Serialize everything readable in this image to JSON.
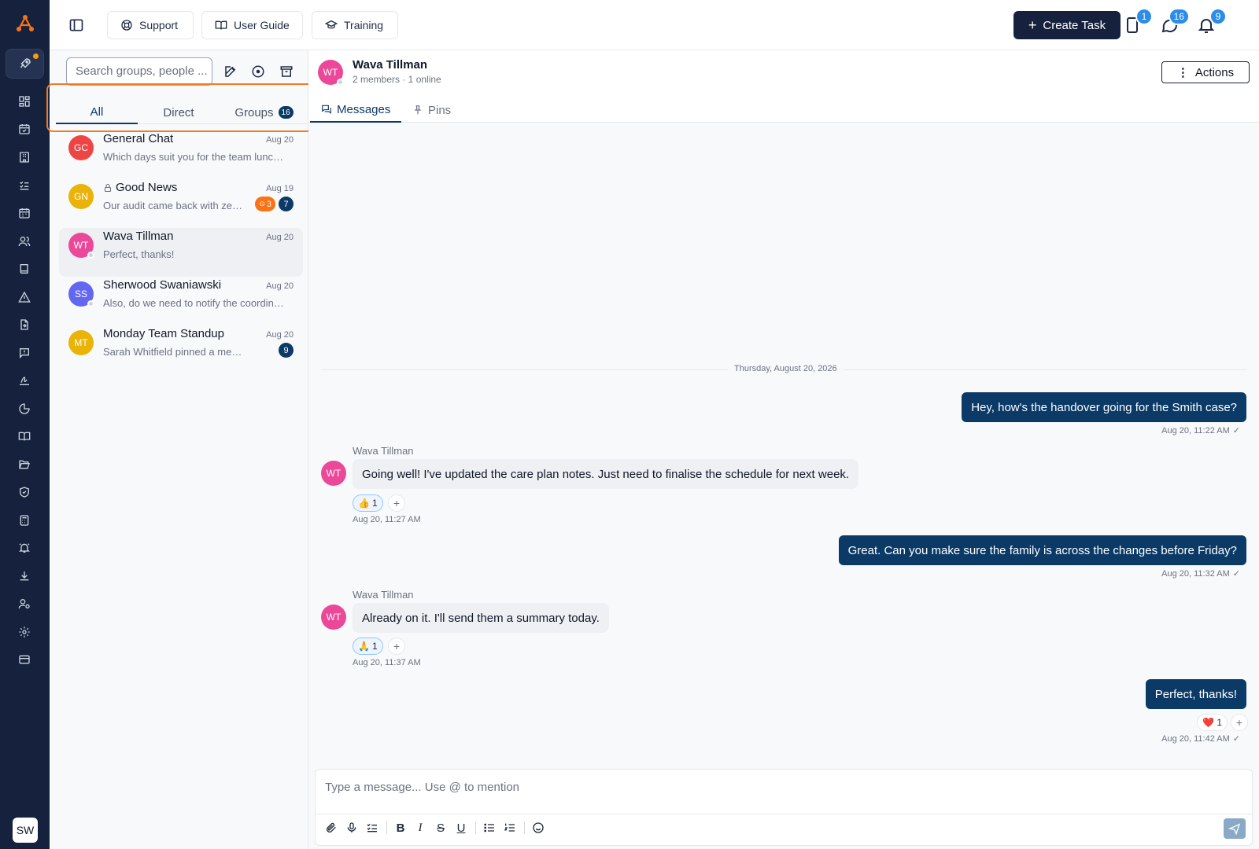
{
  "rail": {
    "user_initials": "SW",
    "icons": [
      "dashboard-icon",
      "calendar-check-icon",
      "building-icon",
      "checklist-icon",
      "calendar-icon",
      "users-icon",
      "book-icon",
      "warning-icon",
      "file-import-icon",
      "message-alert-icon",
      "signature-icon",
      "pie-chart-icon",
      "book-open-icon",
      "folder-open-icon",
      "shield-check-icon",
      "calculator-icon",
      "bell-ring-icon",
      "download-icon",
      "user-cog-icon",
      "settings-icon",
      "credit-card-icon"
    ]
  },
  "topbar": {
    "support_label": "Support",
    "user_guide_label": "User Guide",
    "training_label": "Training",
    "create_task_label": "Create Task",
    "tasks_badge": "1",
    "messages_badge": "16",
    "notifications_badge": "9"
  },
  "list": {
    "search_placeholder": "Search groups, people ...",
    "tabs": [
      {
        "label": "All"
      },
      {
        "label": "Direct"
      },
      {
        "label": "Groups",
        "count": "16"
      }
    ],
    "conversations": [
      {
        "initials": "GC",
        "color": "#ef4444",
        "name": "General Chat",
        "date": "Aug 20",
        "preview": "Which days suit you for the team lunch next week?"
      },
      {
        "initials": "GN",
        "color": "#eab308",
        "name": "Good News",
        "locked": true,
        "date": "Aug 19",
        "preview": "Our audit came back with zero findings!",
        "mention_count": "3",
        "unread": "7"
      },
      {
        "initials": "WT",
        "color": "#ec4899",
        "name": "Wava Tillman",
        "date": "Aug 20",
        "preview": "Perfect, thanks!"
      },
      {
        "initials": "SS",
        "color": "#6366f1",
        "name": "Sherwood Swaniawski",
        "date": "Aug 20",
        "preview": "Also, do we need to notify the coordinator?"
      },
      {
        "initials": "MT",
        "color": "#eab308",
        "name": "Monday Team Standup",
        "date": "Aug 20",
        "preview": "Sarah Whitfield pinned a message",
        "unread": "9"
      }
    ]
  },
  "chat": {
    "initials": "WT",
    "title": "Wava Tillman",
    "subtitle": "2 members · 1 online",
    "actions_label": "Actions",
    "tabs": [
      "Messages",
      "Pins"
    ],
    "date_divider": "Thursday, August 20, 2026",
    "messages": [
      {
        "dir": "out",
        "text": "Hey, how's the handover going for the Smith case?",
        "time": "Aug 20, 11:22 AM"
      },
      {
        "dir": "in",
        "sender": "Wava Tillman",
        "initials": "WT",
        "text": "Going well! I've updated the care plan notes. Just need to finalise the schedule for next week.",
        "reaction": "👍",
        "reaction_count": "1",
        "time": "Aug 20, 11:27 AM"
      },
      {
        "dir": "out",
        "text": "Great. Can you make sure the family is across the changes before Friday?",
        "time": "Aug 20, 11:32 AM"
      },
      {
        "dir": "in",
        "sender": "Wava Tillman",
        "initials": "WT",
        "text": "Already on it. I'll send them a summary today.",
        "reaction": "🙏",
        "reaction_count": "1",
        "time": "Aug 20, 11:37 AM"
      },
      {
        "dir": "out",
        "text": "Perfect, thanks!",
        "reaction": "❤️",
        "reaction_count": "1",
        "time": "Aug 20, 11:42 AM"
      }
    ],
    "composer_placeholder": "Type a message... Use @ to mention"
  },
  "colors": {
    "rail_bg": "#16213d",
    "accent": "#0b3a67",
    "highlight": "#f27a24",
    "badge_blue": "#2b8de8"
  }
}
